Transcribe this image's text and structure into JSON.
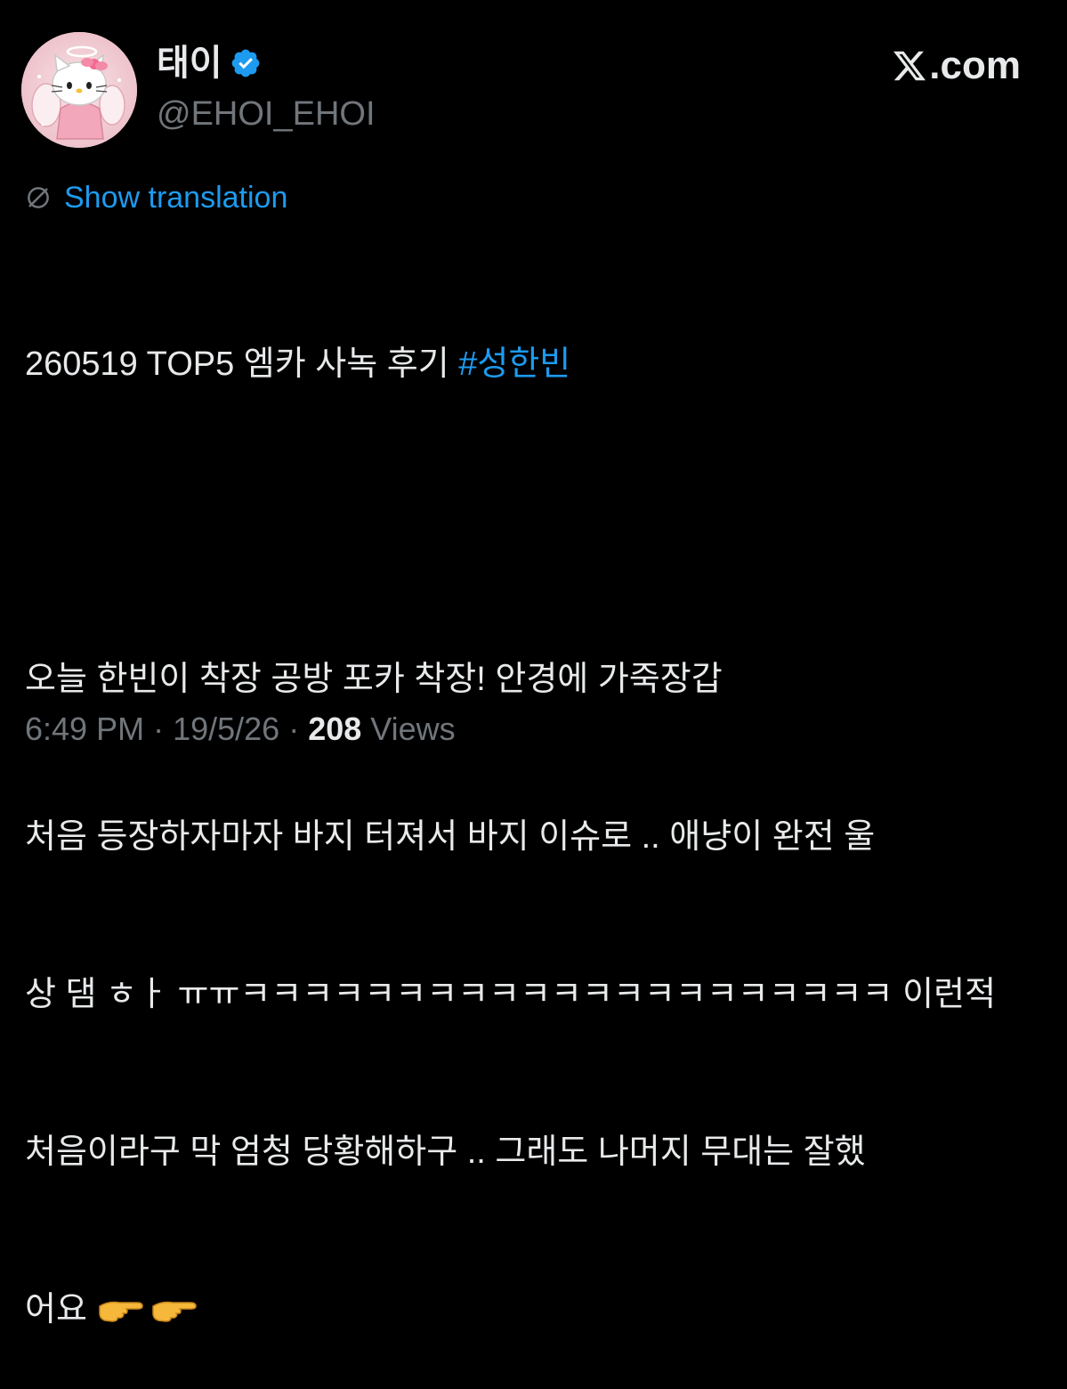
{
  "author": {
    "display_name": "태이",
    "handle": "@EHOI_EHOI",
    "verified": true,
    "avatar_icon": "hello-kitty-angel-avatar"
  },
  "brand": {
    "text": ".com",
    "icon": "x-logo-icon"
  },
  "translation": {
    "label": "Show translation",
    "icon": "translate-globe-icon"
  },
  "tweet": {
    "first_line_text": "260519 TOP5 엠카 사녹 후기 ",
    "hashtag": "#성한빈",
    "lines": [
      "오늘 한빈이 착장 공방 포카 착장! 안경에 가죽장갑",
      "처음 등장하자마자 바지 터져서 바지 이슈로 .. 애냥이 완전 울",
      "상 댐 ㅎㅏ ㅠㅠㅋㅋㅋㅋㅋㅋㅋㅋㅋㅋㅋㅋㅋㅋㅋㅋㅋㅋㅋㅋㅋ 이런적",
      "처음이라구 막 엄청 당황해하구 .. 그래도 나머지 무대는 잘했",
      "어요 "
    ],
    "emoji": [
      "pointing-hand-emoji",
      "pointing-hand-emoji"
    ]
  },
  "meta": {
    "time": "6:49 PM",
    "separator": "·",
    "date": "19/5/26",
    "views_count": "208",
    "views_label": "Views"
  },
  "colors": {
    "background": "#000000",
    "text": "#e7e9ea",
    "secondary": "#71767b",
    "link": "#1d9bf0",
    "verified": "#1d9bf0"
  }
}
